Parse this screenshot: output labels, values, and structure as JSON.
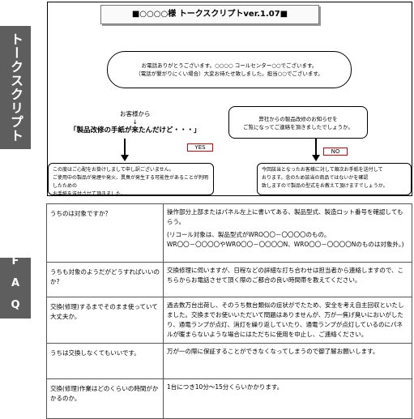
{
  "side_tabs": {
    "talk_script": "トークスクリプト",
    "faq": "FAQ"
  },
  "script": {
    "title": "■○○○○様 トークスクリプトver.1.07■",
    "greeting": [
      "お電話ありがとうございます。○○○○ コールセンター○○でございます。",
      "（電話が繋がりにくい場合）大変お待たせ致しました。担当○○でございます。"
    ],
    "customer": {
      "label": "お客様から",
      "arrow": "↓",
      "quote": "「製品改修の手紙が来たんだけど・・・」"
    },
    "decision": [
      "弊社からの製品改修のお知らせを",
      "ご覧になってご連絡を頂きましたでしょうか。"
    ],
    "yes_label": "YES",
    "no_label": "NO",
    "yes_response": [
      "この度はご心配をお掛けしまして申し訳ございません。",
      "ご使用中の製品が発煙や発火、異臭が発生する可能性があることが判明したための ご使用中の製品が発煙や発火、異臭が発生する可能性があることが判明したための 次第です。",
      "お手紙を送付させて頂きました。"
    ],
    "no_response": [
      "今回該当となったお客様に対して順次お手紙を送付して",
      "おります。念のため該当の商品ではないかを確認",
      "致しますので製品の型式をお教えて頂けますでしょうか。"
    ]
  },
  "faq": {
    "rows": [
      {
        "q": "うちのは対象ですか？",
        "a": "操作部分上部またはパネル左上に書いてある、製品型式、製造ロット番号を確認してもらう。",
        "note": "(リコール対象は、製品型式がWRO〇〇－〇〇〇〇のもの。",
        "examples": "WR〇〇－〇〇〇〇やWRO〇〇－〇〇〇〇N、WRO〇〇－〇〇〇〇Nのものは対象外。)"
      },
      {
        "q": "うちも対象のようだがどうすればいいのか?",
        "a": "交換修理に伺いますが、日程などの詳細な打ち合わせは担当者から連絡しますので、こちらからお電話させて頂く際のご都合の良い時間帯を教えてください。"
      },
      {
        "q": "交換(修理)するまでそのまま使っていて大丈夫か。",
        "a": "過去数万台出荷し、そのうち数台類似の症状がでたため、安全を考え自主回収といたしました。交換までお使いいただいて問題はありませんが、万が一焦げ臭いにおいがしたり、通電ランプが点灯、消灯を繰り返していたり、通電ランプが点灯しているのにパネルが暖まらないような場合にはただちに使用を中止し、ご連絡ください。"
      },
      {
        "q": "うちは交換しなくてもいいです。",
        "a": "万が一の際に保証することができなくなってしまうので御了解お願いします。"
      },
      {
        "q": "交換(修理)作業はどのくらいの時間がかかるのか。",
        "a": "1台につき10分～15分くらいかかります。"
      }
    ]
  }
}
